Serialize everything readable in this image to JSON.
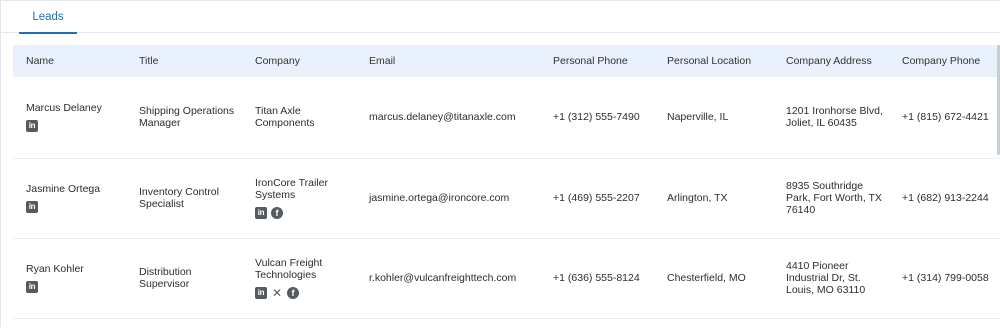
{
  "tabs": [
    {
      "label": "Leads",
      "active": true
    }
  ],
  "columns": [
    "Name",
    "Title",
    "Company",
    "Email",
    "Personal Phone",
    "Personal Location",
    "Company Address",
    "Company Phone"
  ],
  "rows": [
    {
      "name": "Marcus Delaney",
      "name_icons": [
        "linkedin-icon"
      ],
      "title": "Shipping Operations Manager",
      "company": "Titan Axle Components",
      "company_icons": [],
      "email": "marcus.delaney@titanaxle.com",
      "personal_phone": "+1 (312) 555-7490",
      "personal_location": "Naperville, IL",
      "company_address": "1201 Ironhorse Blvd, Joliet, IL 60435",
      "company_phone": "+1 (815) 672-4421"
    },
    {
      "name": "Jasmine Ortega",
      "name_icons": [
        "linkedin-icon"
      ],
      "title": "Inventory Control Specialist",
      "company": "IronCore Trailer Systems",
      "company_icons": [
        "linkedin-icon",
        "facebook-icon"
      ],
      "email": "jasmine.ortega@ironcore.com",
      "personal_phone": "+1 (469) 555-2207",
      "personal_location": "Arlington, TX",
      "company_address": "8935 Southridge Park, Fort Worth, TX 76140",
      "company_phone": "+1 (682) 913-2244"
    },
    {
      "name": "Ryan Kohler",
      "name_icons": [
        "linkedin-icon"
      ],
      "title": "Distribution Supervisor",
      "company": "Vulcan Freight Technologies",
      "company_icons": [
        "linkedin-icon",
        "x-icon",
        "facebook-icon"
      ],
      "email": "r.kohler@vulcanfreighttech.com",
      "personal_phone": "+1 (636) 555-8124",
      "personal_location": "Chesterfield, MO",
      "company_address": "4410 Pioneer Industrial Dr, St. Louis, MO 63110",
      "company_phone": "+1 (314) 799-0058"
    }
  ],
  "colors": {
    "accent": "#1e6fb8",
    "header_bg": "#e8f1fc",
    "icon": "#555b61"
  }
}
